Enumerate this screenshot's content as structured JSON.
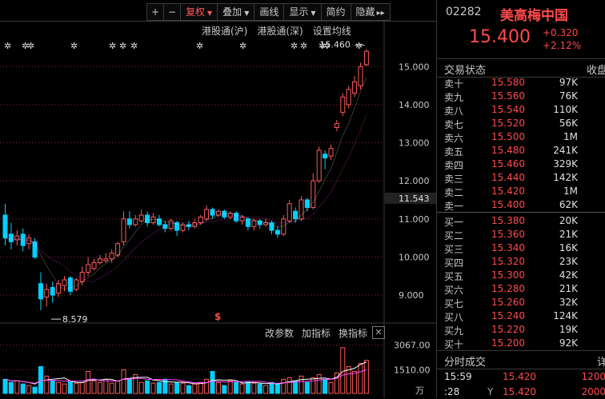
{
  "toolbar": {
    "plus": "+",
    "minus": "−",
    "adjust": "复权",
    "overlay": "叠加",
    "draw": "画线",
    "display": "显示",
    "simple": "简约",
    "hide": "隐藏",
    "more": "▸▸"
  },
  "chart_links": {
    "hk_sh": "港股通(沪)",
    "hk_sz": "港股通(深)",
    "ma_settings": "设置均线"
  },
  "indicator_links": {
    "params": "改参数",
    "add": "加指标",
    "switch": "换指标",
    "close": "✕"
  },
  "chart_data": {
    "type": "candlestick",
    "price_axis_ticks": [
      "15.000",
      "14.000",
      "13.000",
      "12.000",
      "11.000",
      "10.000",
      "9.000"
    ],
    "price_ticks_values": [
      15,
      14,
      13,
      12,
      11,
      10,
      9
    ],
    "ylim": [
      8.35,
      15.95
    ],
    "current_label": "11.543",
    "current_value": 11.543,
    "high_marker": "15.460",
    "high_value": 15.46,
    "low_marker": "8.579",
    "low_value": 8.579,
    "s_marker": "$",
    "volume_axis_ticks": [
      "3067.00",
      "1510.00"
    ],
    "volume_ticks_values": [
      3067,
      1510
    ],
    "volume_ylim": [
      0,
      3300
    ],
    "volume_unit": "万",
    "up_color": "#ff5a5a",
    "down_color": "#00d0ff",
    "ma_color_1": "#ffffff",
    "ma_color_2": "#ff44ff",
    "candles": [
      [
        11.1,
        10.5,
        11.4,
        10.3
      ],
      [
        10.6,
        10.4,
        10.9,
        10.2
      ],
      [
        10.45,
        10.55,
        10.7,
        10.3
      ],
      [
        10.6,
        10.3,
        10.75,
        10.15
      ],
      [
        10.35,
        10.5,
        10.6,
        10.2
      ],
      [
        10.4,
        10.0,
        10.5,
        9.95
      ],
      [
        9.3,
        8.9,
        9.6,
        8.6
      ],
      [
        8.95,
        9.15,
        9.3,
        8.7
      ],
      [
        9.2,
        9.0,
        9.35,
        8.8
      ],
      [
        9.05,
        9.3,
        9.4,
        8.95
      ],
      [
        9.25,
        9.4,
        9.5,
        9.1
      ],
      [
        9.45,
        9.1,
        9.5,
        9.0
      ],
      [
        9.15,
        9.4,
        9.45,
        9.1
      ],
      [
        9.35,
        9.6,
        9.75,
        9.25
      ],
      [
        9.6,
        9.8,
        10.0,
        9.5
      ],
      [
        9.7,
        9.85,
        9.95,
        9.65
      ],
      [
        9.85,
        9.95,
        10.05,
        9.8
      ],
      [
        9.9,
        9.95,
        10.1,
        9.85
      ],
      [
        9.95,
        10.1,
        10.2,
        9.85
      ],
      [
        10.05,
        10.35,
        10.4,
        10.0
      ],
      [
        10.4,
        11.0,
        11.2,
        10.3
      ],
      [
        11.0,
        10.85,
        11.2,
        10.75
      ],
      [
        10.85,
        11.0,
        11.1,
        10.8
      ],
      [
        10.95,
        11.1,
        11.25,
        10.9
      ],
      [
        11.1,
        10.9,
        11.2,
        10.8
      ],
      [
        10.9,
        11.05,
        11.15,
        10.85
      ],
      [
        11.0,
        10.85,
        11.1,
        10.8
      ],
      [
        10.85,
        10.75,
        10.95,
        10.65
      ],
      [
        10.75,
        10.95,
        11.0,
        10.7
      ],
      [
        10.9,
        10.7,
        10.95,
        10.55
      ],
      [
        10.7,
        10.85,
        10.9,
        10.65
      ],
      [
        10.85,
        10.8,
        10.95,
        10.7
      ],
      [
        10.8,
        10.9,
        11.0,
        10.75
      ],
      [
        10.9,
        11.05,
        11.1,
        10.85
      ],
      [
        11.0,
        11.25,
        11.35,
        10.95
      ],
      [
        11.25,
        11.1,
        11.3,
        11.0
      ],
      [
        11.1,
        11.2,
        11.25,
        11.05
      ],
      [
        11.2,
        11.05,
        11.25,
        11.0
      ],
      [
        11.05,
        11.15,
        11.2,
        11.0
      ],
      [
        11.15,
        10.95,
        11.2,
        10.9
      ],
      [
        10.95,
        11.05,
        11.1,
        10.85
      ],
      [
        11.0,
        10.8,
        11.05,
        10.7
      ],
      [
        10.8,
        10.95,
        11.0,
        10.7
      ],
      [
        10.95,
        10.85,
        11.0,
        10.75
      ],
      [
        10.85,
        10.9,
        11.0,
        10.8
      ],
      [
        10.9,
        10.7,
        10.95,
        10.6
      ],
      [
        10.7,
        10.6,
        10.8,
        10.5
      ],
      [
        10.6,
        11.0,
        11.1,
        10.55
      ],
      [
        10.95,
        11.4,
        11.5,
        10.9
      ],
      [
        11.2,
        11.0,
        11.3,
        10.9
      ],
      [
        11.0,
        11.5,
        11.6,
        10.95
      ],
      [
        11.5,
        11.3,
        11.55,
        11.2
      ],
      [
        11.3,
        12.0,
        12.2,
        11.25
      ],
      [
        12.0,
        12.8,
        12.9,
        11.95
      ],
      [
        12.7,
        12.6,
        12.8,
        12.3
      ],
      [
        12.65,
        12.85,
        12.95,
        12.55
      ],
      [
        13.4,
        13.5,
        13.6,
        13.3
      ],
      [
        13.8,
        14.2,
        14.3,
        13.7
      ],
      [
        14.0,
        14.4,
        14.5,
        13.9
      ],
      [
        14.3,
        14.6,
        14.75,
        14.2
      ],
      [
        14.5,
        15.0,
        15.1,
        14.4
      ],
      [
        15.05,
        15.4,
        15.46,
        15.0
      ]
    ],
    "volumes": [
      900,
      700,
      800,
      600,
      500,
      400,
      1700,
      1100,
      800,
      700,
      600,
      750,
      650,
      700,
      1400,
      800,
      700,
      900,
      650,
      800,
      1500,
      900,
      1200,
      700,
      800,
      650,
      700,
      900,
      600,
      700,
      650,
      500,
      600,
      700,
      900,
      1400,
      700,
      500,
      800,
      700,
      600,
      750,
      650,
      600,
      500,
      700,
      600,
      900,
      1000,
      800,
      1100,
      700,
      1000,
      1200,
      900,
      700,
      1300,
      2900,
      1700,
      1400,
      1900,
      2100
    ]
  },
  "quote": {
    "code": "02282",
    "name": "美高梅中国",
    "price": "15.400",
    "change": "+0.320",
    "change_pct": "+2.12%"
  },
  "status_row": {
    "left": "交易状态",
    "right": "收盘"
  },
  "asks": [
    {
      "label": "卖十",
      "price": "15.580",
      "vol": "97K"
    },
    {
      "label": "卖九",
      "price": "15.560",
      "vol": "76K"
    },
    {
      "label": "卖八",
      "price": "15.540",
      "vol": "110K"
    },
    {
      "label": "卖七",
      "price": "15.520",
      "vol": "56K"
    },
    {
      "label": "卖六",
      "price": "15.500",
      "vol": "1M"
    },
    {
      "label": "卖五",
      "price": "15.480",
      "vol": "241K"
    },
    {
      "label": "卖四",
      "price": "15.460",
      "vol": "329K"
    },
    {
      "label": "卖三",
      "price": "15.440",
      "vol": "142K"
    },
    {
      "label": "卖二",
      "price": "15.420",
      "vol": "1M"
    },
    {
      "label": "卖一",
      "price": "15.400",
      "vol": "62K"
    }
  ],
  "bids": [
    {
      "label": "买一",
      "price": "15.380",
      "vol": "20K"
    },
    {
      "label": "买二",
      "price": "15.360",
      "vol": "21K"
    },
    {
      "label": "买三",
      "price": "15.340",
      "vol": "16K"
    },
    {
      "label": "买四",
      "price": "15.320",
      "vol": "23K"
    },
    {
      "label": "买五",
      "price": "15.300",
      "vol": "42K"
    },
    {
      "label": "买六",
      "price": "15.280",
      "vol": "21K"
    },
    {
      "label": "买七",
      "price": "15.260",
      "vol": "32K"
    },
    {
      "label": "买八",
      "price": "15.240",
      "vol": "124K"
    },
    {
      "label": "买九",
      "price": "15.220",
      "vol": "19K"
    },
    {
      "label": "买十",
      "price": "15.200",
      "vol": "92K"
    }
  ],
  "trades_header": {
    "left": "分时成交",
    "right": "详"
  },
  "trades": [
    {
      "time": "15:59",
      "flag": "",
      "price": "15.420",
      "vol": "1200"
    },
    {
      "time": ":28",
      "flag": "Y",
      "price": "15.420",
      "vol": "2000"
    }
  ]
}
